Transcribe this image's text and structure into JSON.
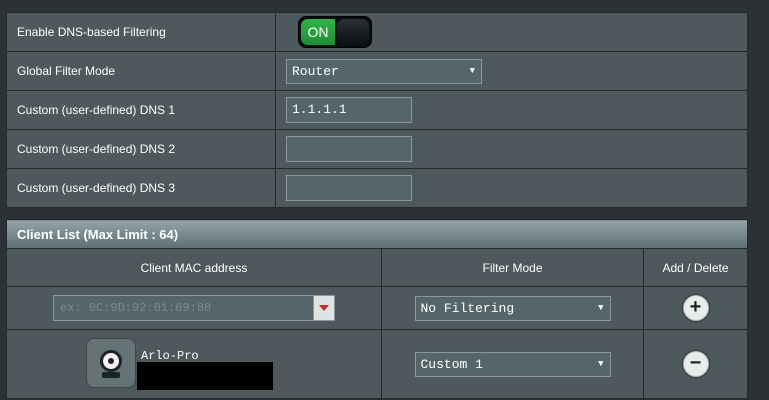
{
  "settings": {
    "rows": [
      {
        "label": "Enable DNS-based Filtering",
        "toggle_label": "ON"
      },
      {
        "label": "Global Filter Mode",
        "select_value": "Router"
      },
      {
        "label": "Custom (user-defined) DNS 1",
        "input_value": "1.1.1.1"
      },
      {
        "label": "Custom (user-defined) DNS 2",
        "input_value": ""
      },
      {
        "label": "Custom (user-defined) DNS 3",
        "input_value": ""
      }
    ]
  },
  "client_list": {
    "title": "Client List (Max Limit : 64)",
    "columns": [
      "Client MAC address",
      "Filter Mode",
      "Add / Delete"
    ],
    "new_entry": {
      "mac_placeholder": "ex: 0C:9D:92:01:69:80",
      "filter_mode": "No Filtering",
      "action_icon": "plus-circle-icon"
    },
    "entries": [
      {
        "device_name": "Arlo-Pro",
        "avatar_icon": "webcam-icon",
        "filter_mode": "Custom 1",
        "action_icon": "minus-circle-icon"
      }
    ]
  },
  "colors": {
    "page_bg": "#2b3134",
    "cell_bg": "#4d595d",
    "toggle_on": "#34b34a",
    "header_gradient_top": "#93a3a7"
  }
}
